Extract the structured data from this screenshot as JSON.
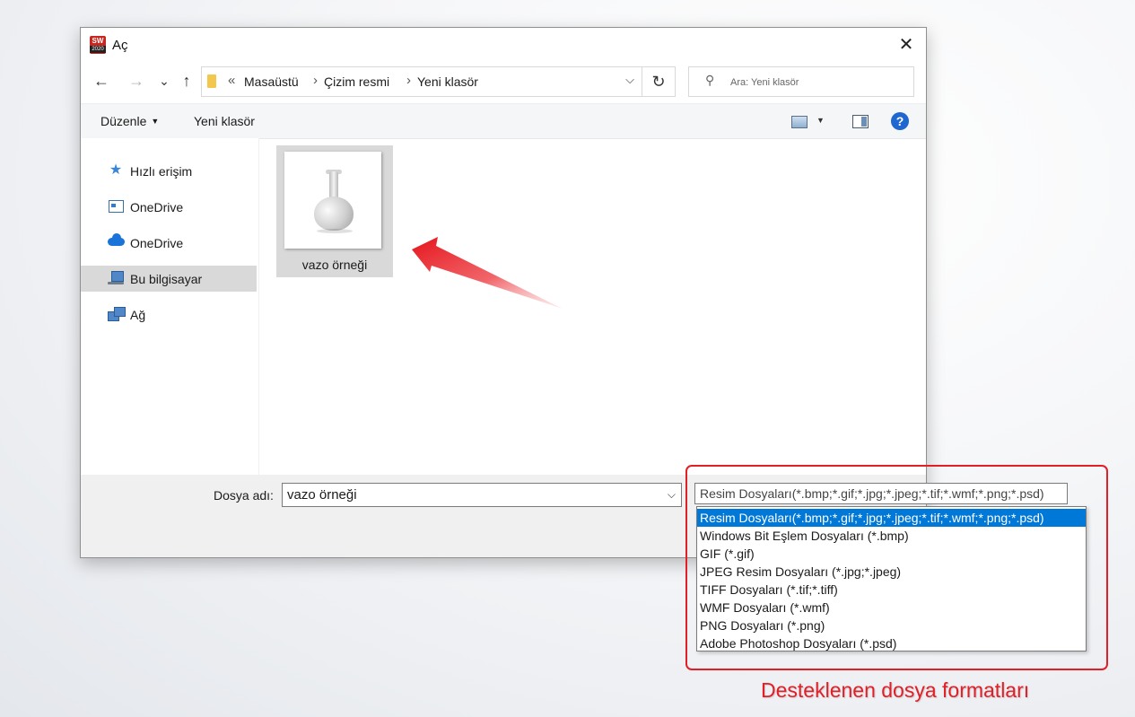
{
  "window": {
    "title": "Aç",
    "app_icon_text": "SW",
    "app_icon_year": "2020"
  },
  "navigation": {
    "back_glyph": "←",
    "forward_glyph": "→",
    "recent_glyph": "⌄",
    "up_glyph": "↑",
    "breadcrumb_prefix": "«",
    "breadcrumb": [
      "Masaüstü",
      "Çizim resmi",
      "Yeni klasör"
    ],
    "refresh_glyph": "↻",
    "search_placeholder": "Ara: Yeni klasör"
  },
  "toolbar": {
    "organize": "Düzenle",
    "new_folder": "Yeni klasör",
    "help": "?"
  },
  "sidebar": {
    "items": [
      {
        "label": "Hızlı erişim",
        "icon": "star-icon"
      },
      {
        "label": "OneDrive",
        "icon": "onedrive-window-icon"
      },
      {
        "label": "OneDrive",
        "icon": "cloud-icon"
      },
      {
        "label": "Bu bilgisayar",
        "icon": "computer-icon",
        "selected": true
      },
      {
        "label": "Ağ",
        "icon": "network-icon"
      }
    ]
  },
  "files": [
    {
      "name": "vazo örneği"
    }
  ],
  "bottom": {
    "filename_label": "Dosya adı:",
    "filename_value": "vazo örneği",
    "filetype_selected": "Resim Dosyaları(*.bmp;*.gif;*.jpg;*.jpeg;*.tif;*.wmf;*.png;*.psd)",
    "filetype_options": [
      "Resim Dosyaları(*.bmp;*.gif;*.jpg;*.jpeg;*.tif;*.wmf;*.png;*.psd)",
      "Windows Bit Eşlem Dosyaları (*.bmp)",
      "GIF (*.gif)",
      "JPEG Resim Dosyaları (*.jpg;*.jpeg)",
      "TIFF Dosyaları (*.tif;*.tiff)",
      "WMF Dosyaları (*.wmf)",
      "PNG Dosyaları (*.png)",
      "Adobe Photoshop Dosyaları (*.psd)"
    ]
  },
  "annotation": {
    "caption": "Desteklenen dosya formatları",
    "color": "#e21f26"
  },
  "colors": {
    "accent": "#0078d7",
    "selection": "#d9d9d9"
  }
}
